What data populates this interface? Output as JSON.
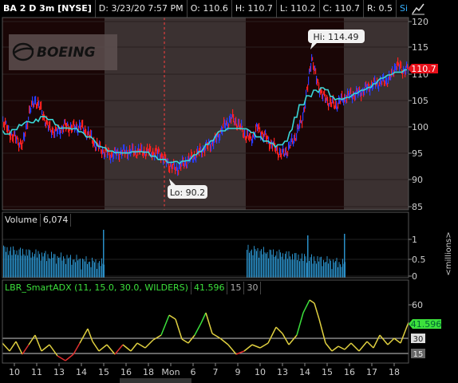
{
  "header": {
    "symbol": "BA 2 D 3m [NYSE]",
    "date": "D: 3/23/20 7:57 PM",
    "open": "O: 110.6",
    "high": "H: 110.7",
    "low": "L: 110.2",
    "close": "C: 110.7",
    "range": "R: 0.5",
    "study": "Simple...",
    "config_icon": "chart-settings-icon"
  },
  "price_pane": {
    "logo": "BOEING",
    "hi_label": "Hi: 114.49",
    "lo_label": "Lo: 90.2",
    "last_price": "110.7",
    "y_ticks": [
      "120",
      "115",
      "110",
      "105",
      "100",
      "95",
      "90",
      "85"
    ],
    "colors": {
      "up": "#2a3cff",
      "down": "#ff2020",
      "ma": "#3ad6d6",
      "last": "#e8101a"
    }
  },
  "volume_pane": {
    "title": "Volume",
    "value": "6,074",
    "y_ticks": [
      "1",
      "0.5",
      "0"
    ],
    "unit_label": "<millions>",
    "color": "#2a8fc8"
  },
  "adx_pane": {
    "title": "LBR_SmartADX (11, 15.0, 30.0, WILDERS)",
    "value": "41.596",
    "level_15": "15",
    "level_30": "30",
    "y_ticks": [
      "60",
      "30",
      "15"
    ],
    "value_badge": "41.596",
    "badge_30": "30",
    "badge_15": "15"
  },
  "x_axis": {
    "labels": [
      "10",
      "11",
      "13",
      "14",
      "15",
      "16",
      "18",
      "Mon",
      "6",
      "7",
      "9",
      "10",
      "13",
      "14",
      "15",
      "16",
      "17",
      "18"
    ]
  }
}
